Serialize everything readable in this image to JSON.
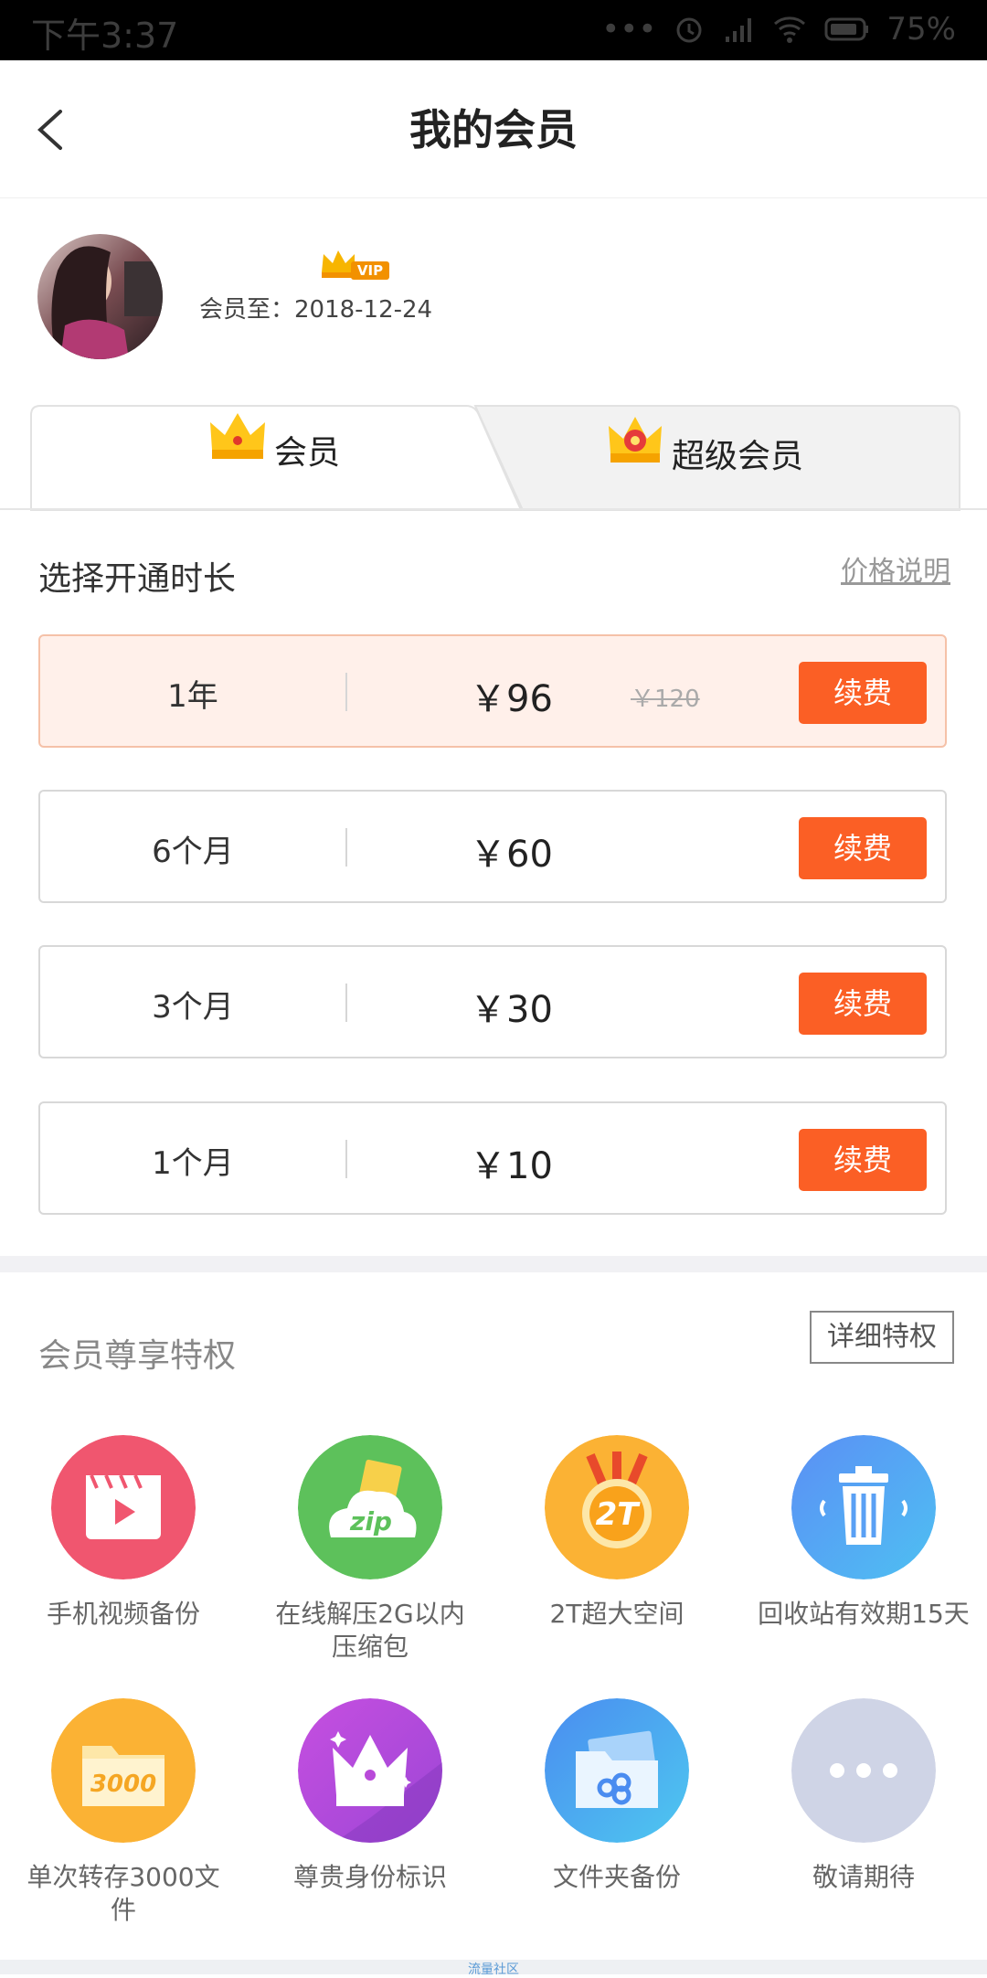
{
  "status_bar": {
    "time": "下午3:37",
    "dots": "•••",
    "battery": "75%"
  },
  "header": {
    "title": "我的会员"
  },
  "profile": {
    "vip_badge": "VIP",
    "expire_text": "会员至：2018-12-24"
  },
  "tabs": [
    {
      "label": "会员"
    },
    {
      "label": "超级会员"
    }
  ],
  "duration": {
    "section_label": "选择开通时长",
    "price_info_link": "价格说明",
    "plans": [
      {
        "duration": "1年",
        "price": "￥96",
        "original_price": "￥120",
        "button": "续费"
      },
      {
        "duration": "6个月",
        "price": "￥60",
        "button": "续费"
      },
      {
        "duration": "3个月",
        "price": "￥30",
        "button": "续费"
      },
      {
        "duration": "1个月",
        "price": "￥10",
        "button": "续费"
      }
    ]
  },
  "perks": {
    "title": "会员尊享特权",
    "detail_button": "详细特权",
    "items": [
      {
        "label": "手机视频备份",
        "icon": "video-icon",
        "icon_text": ""
      },
      {
        "label": "在线解压2G以内压缩包",
        "icon": "zip-cloud-icon",
        "icon_text": "zip"
      },
      {
        "label": "2T超大空间",
        "icon": "medal-2t-icon",
        "icon_text": "2T"
      },
      {
        "label": "回收站有效期15天",
        "icon": "trash-icon",
        "icon_text": ""
      },
      {
        "label": "单次转存3000文件",
        "icon": "folder-3000-icon",
        "icon_text": "3000"
      },
      {
        "label": "尊贵身份标识",
        "icon": "crown-icon",
        "icon_text": ""
      },
      {
        "label": "文件夹备份",
        "icon": "folder-cloud-icon",
        "icon_text": ""
      },
      {
        "label": "敬请期待",
        "icon": "more-icon",
        "icon_text": ""
      }
    ]
  },
  "footer": {
    "watermark": "流量社区"
  },
  "colors": {
    "accent": "#fb5f25",
    "active_plan_bg": "#fff0ea"
  }
}
